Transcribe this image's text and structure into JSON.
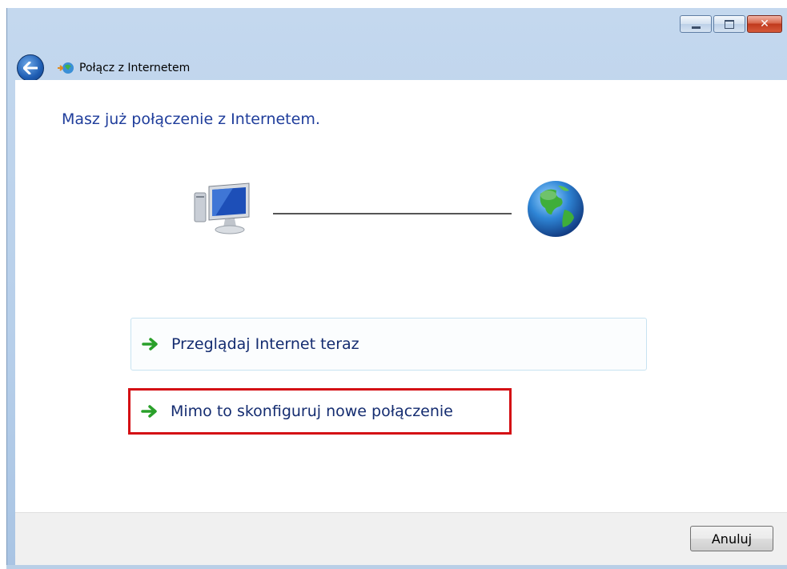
{
  "window": {
    "title": "Połącz z Internetem",
    "caption_buttons": {
      "minimize": "",
      "maximize": "",
      "close": "✕"
    }
  },
  "main": {
    "heading": "Masz już połączenie z Internetem.",
    "options": [
      {
        "label": "Przeglądaj Internet teraz",
        "icon": "green-arrow-icon"
      },
      {
        "label": "Mimo to skonfiguruj nowe połączenie",
        "icon": "green-arrow-icon",
        "highlighted": true
      }
    ]
  },
  "footer": {
    "cancel_label": "Anuluj"
  },
  "colors": {
    "heading": "#1f3d9b",
    "command_text": "#142c70",
    "highlight_border": "#d40f14",
    "arrow": "#2aa02a"
  },
  "icons": {
    "back": "back-arrow-icon",
    "wizard": "network-connection-icon",
    "computer": "computer-icon",
    "globe": "internet-globe-icon"
  }
}
